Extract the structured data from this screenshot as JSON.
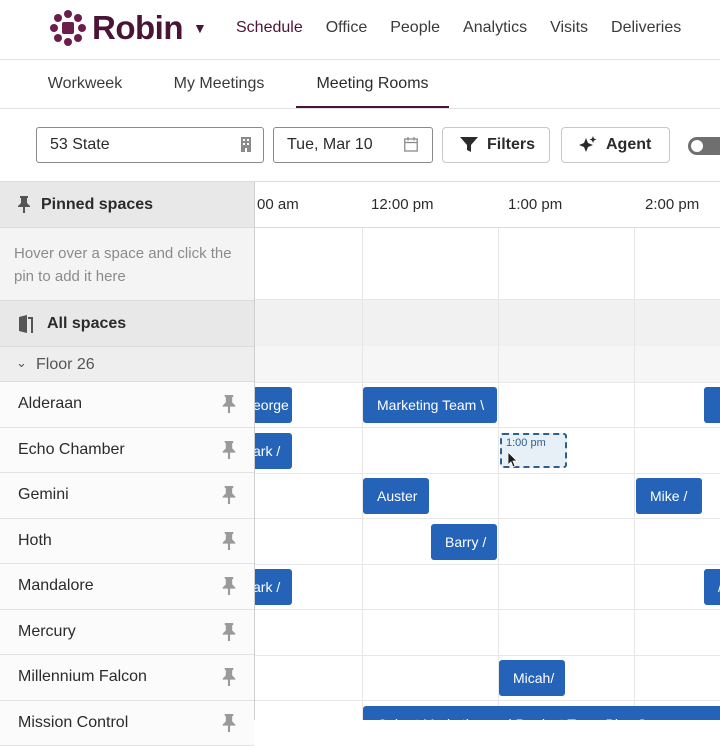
{
  "app": {
    "brand": "Robin",
    "brand_color": "#4a1437",
    "accent_color": "#2563b8"
  },
  "nav": {
    "items": [
      "Schedule",
      "Office",
      "People",
      "Analytics",
      "Visits",
      "Deliveries"
    ]
  },
  "subtabs": {
    "items": [
      "Workweek",
      "My Meetings",
      "Meeting Rooms"
    ],
    "active": "Meeting Rooms"
  },
  "toolbar": {
    "location": "53 State",
    "date": "Tue, Mar 10",
    "filters_label": "Filters",
    "agent_label": "Agent",
    "toggle_on": false
  },
  "left_panel": {
    "pinned_title": "Pinned spaces",
    "pinned_hint": "Hover over a space and click the pin to add it here",
    "all_title": "All spaces",
    "floor_label": "Floor 26",
    "rooms": [
      "Alderaan",
      "Echo Chamber",
      "Gemini",
      "Hoth",
      "Mandalore",
      "Mercury",
      "Millennium Falcon",
      "Mission Control"
    ]
  },
  "timeline": {
    "hours": [
      "00 am",
      "12:00 pm",
      "1:00 pm",
      "2:00 pm"
    ],
    "draft_label": "1:00 pm",
    "events": [
      {
        "room": 0,
        "label": "eorge"
      },
      {
        "room": 0,
        "label": "Marketing Team \\"
      },
      {
        "room": 0,
        "label": ""
      },
      {
        "room": 1,
        "label": "ark /"
      },
      {
        "room": 2,
        "label": "Auster"
      },
      {
        "room": 2,
        "label": "Mike /"
      },
      {
        "room": 3,
        "label": "Barry /"
      },
      {
        "room": 4,
        "label": "ark /"
      },
      {
        "room": 4,
        "label": "/"
      },
      {
        "room": 6,
        "label": "Micah/"
      },
      {
        "room": 7,
        "label": "Cohort Marketing and Product Team Blue Sync"
      }
    ]
  }
}
